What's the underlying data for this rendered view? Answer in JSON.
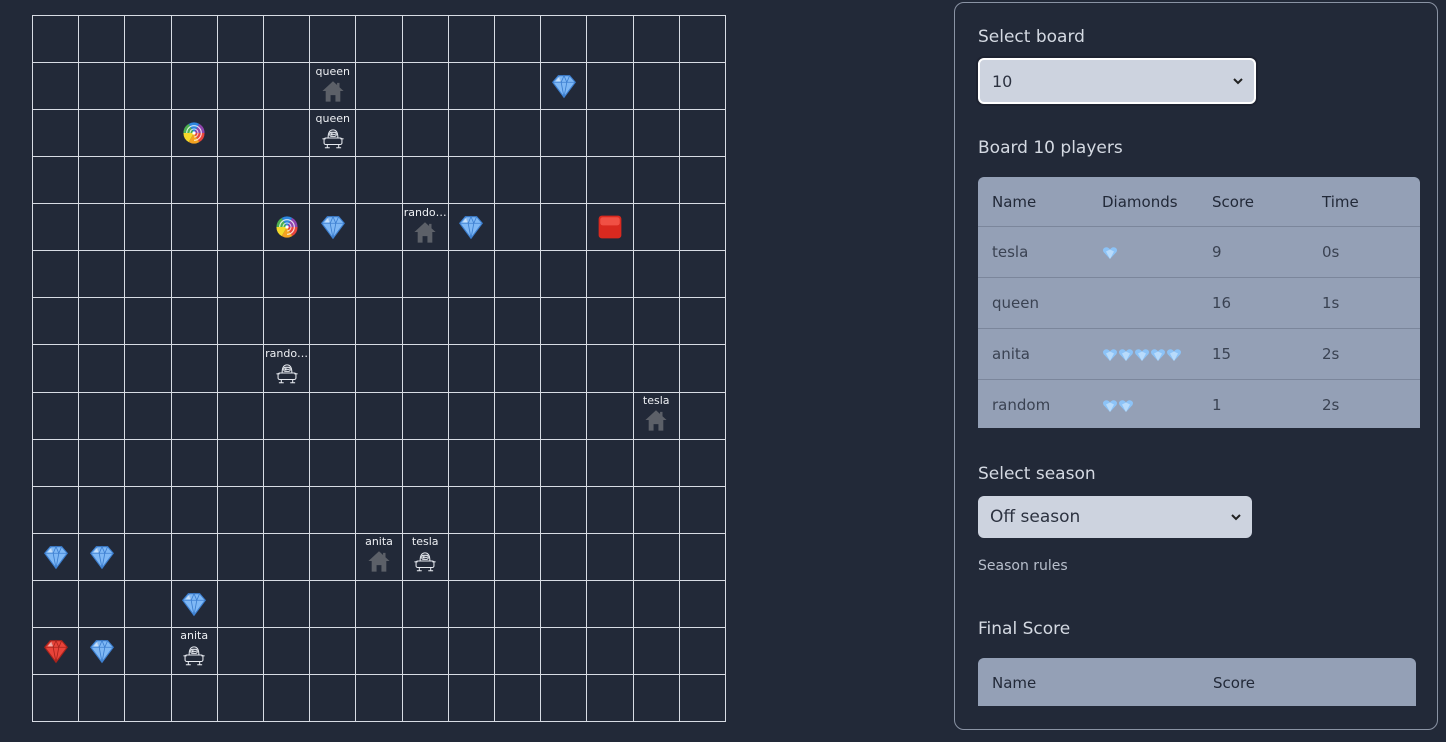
{
  "board": {
    "rows": 15,
    "cols": 15,
    "items": [
      {
        "row": 1,
        "col": 6,
        "type": "base",
        "label": "queen"
      },
      {
        "row": 1,
        "col": 11,
        "type": "diamond-blue"
      },
      {
        "row": 2,
        "col": 3,
        "type": "teleporter"
      },
      {
        "row": 2,
        "col": 6,
        "type": "bot",
        "label": "queen"
      },
      {
        "row": 4,
        "col": 5,
        "type": "teleporter"
      },
      {
        "row": 4,
        "col": 6,
        "type": "diamond-blue"
      },
      {
        "row": 4,
        "col": 8,
        "type": "base",
        "label": "rando…"
      },
      {
        "row": 4,
        "col": 9,
        "type": "diamond-blue"
      },
      {
        "row": 4,
        "col": 12,
        "type": "red-button"
      },
      {
        "row": 7,
        "col": 5,
        "type": "bot",
        "label": "rando…"
      },
      {
        "row": 8,
        "col": 13,
        "type": "base",
        "label": "tesla"
      },
      {
        "row": 11,
        "col": 0,
        "type": "diamond-blue"
      },
      {
        "row": 11,
        "col": 1,
        "type": "diamond-blue"
      },
      {
        "row": 11,
        "col": 7,
        "type": "base",
        "label": "anita"
      },
      {
        "row": 11,
        "col": 8,
        "type": "bot",
        "label": "tesla"
      },
      {
        "row": 12,
        "col": 3,
        "type": "diamond-blue"
      },
      {
        "row": 13,
        "col": 0,
        "type": "diamond-red"
      },
      {
        "row": 13,
        "col": 1,
        "type": "diamond-blue"
      },
      {
        "row": 13,
        "col": 3,
        "type": "bot",
        "label": "anita"
      }
    ]
  },
  "panel": {
    "select_board_label": "Select board",
    "board_value": "10",
    "players_title": "Board 10 players",
    "players_headers": [
      "Name",
      "Diamonds",
      "Score",
      "Time"
    ],
    "players": [
      {
        "name": "tesla",
        "diamonds": 1,
        "score": "9",
        "time": "0s"
      },
      {
        "name": "queen",
        "diamonds": 0,
        "score": "16",
        "time": "1s"
      },
      {
        "name": "anita",
        "diamonds": 5,
        "score": "15",
        "time": "2s"
      },
      {
        "name": "random",
        "diamonds": 2,
        "score": "1",
        "time": "2s"
      }
    ],
    "select_season_label": "Select season",
    "season_value": "Off season",
    "season_rules": "Season rules",
    "final_score_title": "Final Score",
    "final_headers": [
      "Name",
      "Score"
    ]
  },
  "colors": {
    "background": "#222938",
    "grid_line": "#d8dce4",
    "diamond_blue": "#7fb8f5",
    "diamond_red": "#e8443a",
    "base_gray": "#5c6068",
    "red_button": "#d9291f",
    "table_bg": "#94a0b6",
    "select_bg": "#cdd3df"
  }
}
